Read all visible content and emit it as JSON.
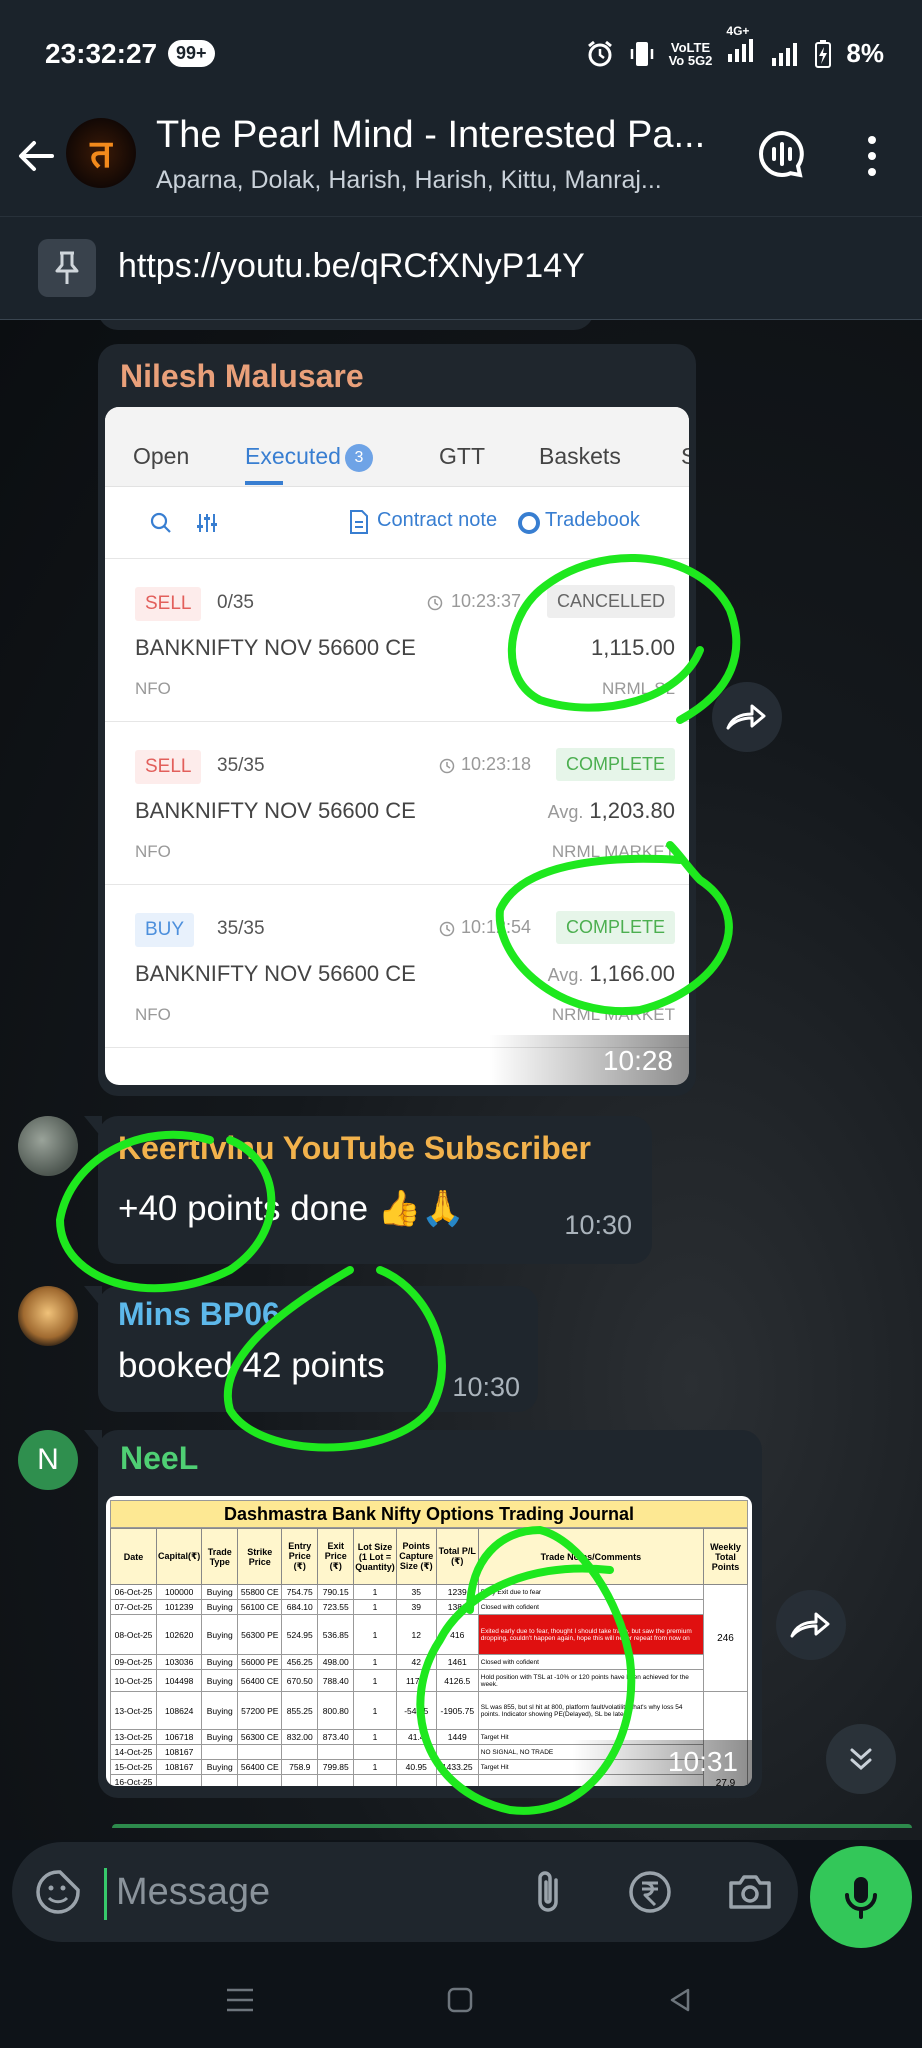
{
  "status_bar": {
    "time": "23:32:27",
    "notif_badge": "99+",
    "volte_top": "VoLTE",
    "volte_bottom": "Vo 5G2",
    "net_label": "4G+",
    "battery": "8%"
  },
  "header": {
    "title": "The Pearl Mind - Interested Pa...",
    "members": "Aparna, Dolak, Harish, Harish, Kittu, Manraj...",
    "avatar_glyph": "त"
  },
  "pinned": {
    "link": "https://youtu.be/qRCfXNyP14Y"
  },
  "messages": {
    "m1": {
      "sender": "Nilesh Malusare",
      "sender_color": "#e9a07a",
      "time": "10:28",
      "broker": {
        "tabs": [
          "Open",
          "Executed",
          "GTT",
          "Baskets",
          "S"
        ],
        "executed_count": "3",
        "contract_note": "Contract note",
        "tradebook": "Tradebook",
        "orders": [
          {
            "side": "SELL",
            "qty": "0/35",
            "time": "10:23:37",
            "status": "CANCELLED",
            "instrument": "BANKNIFTY NOV 56600 CE",
            "avg_label": "",
            "price": "1,115.00",
            "exchange": "NFO",
            "product": "NRML  SL"
          },
          {
            "side": "SELL",
            "qty": "35/35",
            "time": "10:23:18",
            "status": "COMPLETE",
            "instrument": "BANKNIFTY NOV 56600 CE",
            "avg_label": "Avg.",
            "price": "1,203.80",
            "exchange": "NFO",
            "product": "NRML  MARKET"
          },
          {
            "side": "BUY",
            "qty": "35/35",
            "time": "10:12:54",
            "status": "COMPLETE",
            "instrument": "BANKNIFTY NOV 56600 CE",
            "avg_label": "Avg.",
            "price": "1,166.00",
            "exchange": "NFO",
            "product": "NRML  MARKET"
          }
        ]
      }
    },
    "m2": {
      "sender": "Keertivinu YouTube Subscriber",
      "sender_color": "#f2b24c",
      "text": "+40  points done 👍🙏",
      "time": "10:30"
    },
    "m3": {
      "sender": "Mins BP06",
      "sender_color": "#5db8ea",
      "text": "booked 42 points",
      "time": "10:30"
    },
    "m4": {
      "sender": "NeeL",
      "sender_color": "#4fcf74",
      "avatar_letter": "N",
      "time": "10:31",
      "journal": {
        "title": "Dashmastra Bank Nifty Options Trading Journal",
        "headers": [
          "Date",
          "Capital(₹)",
          "Trade Type",
          "Strike Price",
          "Entry Price (₹)",
          "Exit Price (₹)",
          "Lot Size (1 Lot = Quantity)",
          "Points Capture Size (₹)",
          "Total P/L (₹)",
          "Trade Notes/Comments",
          "Weekly Total Points"
        ],
        "rows": [
          [
            "06-Oct-25",
            "100000",
            "Buying",
            "55800 CE",
            "754.75",
            "790.15",
            "1",
            "35",
            "1239",
            "Early Exit due to fear"
          ],
          [
            "07-Oct-25",
            "101239",
            "Buying",
            "56100 CE",
            "684.10",
            "723.55",
            "1",
            "39",
            "1381",
            "Closed with cofident"
          ],
          [
            "08-Oct-25",
            "102620",
            "Buying",
            "56300 PE",
            "524.95",
            "536.85",
            "1",
            "12",
            "416",
            "Exited early due to fear, thought I should take trade, but saw the premium dropping, couldn't happen again, hope this will never repeat from now on"
          ],
          [
            "09-Oct-25",
            "103036",
            "Buying",
            "56000 PE",
            "456.25",
            "498.00",
            "1",
            "42",
            "1461",
            "Closed with cofident"
          ],
          [
            "10-Oct-25",
            "104498",
            "Buying",
            "56400 CE",
            "670.50",
            "788.40",
            "1",
            "117.9",
            "4126.5",
            "Hold position with TSL at -10% or 120 points have been achieved for the week."
          ],
          [
            "13-Oct-25",
            "108624",
            "Buying",
            "57200 PE",
            "855.25",
            "800.80",
            "1",
            "-54.45",
            "-1905.75",
            "SL was 855, but sl hit at 800, platform fault/volatility, that's why loss 54 points. Indicator showing PE(Delayed), SL be later"
          ],
          [
            "13-Oct-25",
            "106718",
            "Buying",
            "56300 CE",
            "832.00",
            "873.40",
            "1",
            "41.4",
            "1449",
            "Target Hit"
          ],
          [
            "14-Oct-25",
            "108167",
            "",
            "",
            "",
            "",
            "",
            "",
            "",
            "NO SIGNAL, NO TRADE"
          ],
          [
            "15-Oct-25",
            "108167",
            "Buying",
            "56400 CE",
            "758.9",
            "799.85",
            "1",
            "40.95",
            "1433.25",
            "Target Hit"
          ],
          [
            "16-Oct-25",
            "",
            "",
            "",
            "",
            "",
            "",
            "",
            "",
            ""
          ]
        ],
        "weekly_totals": [
          "246",
          "27.9"
        ]
      }
    }
  },
  "input": {
    "placeholder": "Message"
  },
  "colors": {
    "accent_green": "#33c759",
    "annotation_green": "#1ee81e"
  }
}
